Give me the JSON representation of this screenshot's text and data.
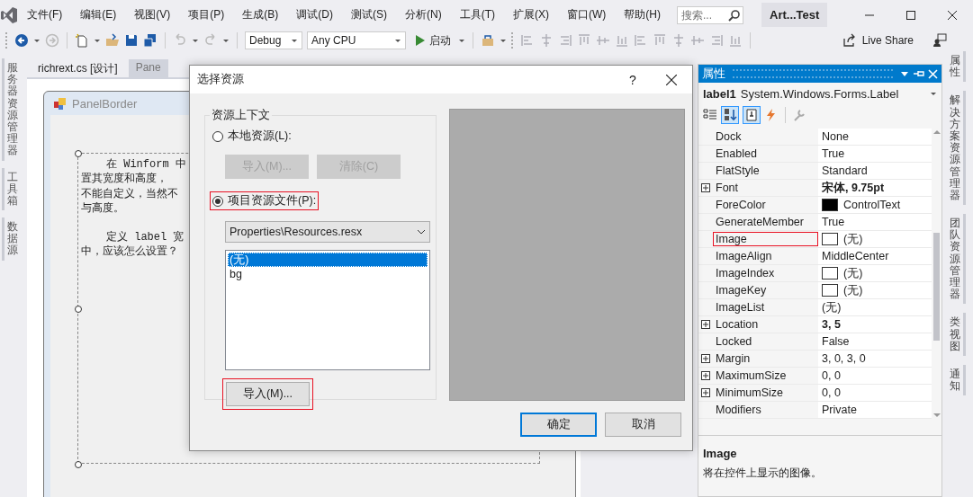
{
  "menu": [
    "文件(F)",
    "编辑(E)",
    "视图(V)",
    "项目(P)",
    "生成(B)",
    "调试(D)",
    "测试(S)",
    "分析(N)",
    "工具(T)",
    "扩展(X)",
    "窗口(W)",
    "帮助(H)"
  ],
  "search": {
    "placeholder": "搜索..."
  },
  "window": {
    "title": "Art...Test"
  },
  "toolbar": {
    "configuration": "Debug",
    "platform": "Any CPU",
    "start": "启动",
    "live_share": "Live Share"
  },
  "left_tabs": [
    "服务器资源管理器",
    "工具箱",
    "数据源"
  ],
  "documents": {
    "tabs": [
      {
        "label": "richrext.cs [设计]",
        "selected": false
      },
      {
        "label": "Pane",
        "selected": true
      }
    ],
    "form": {
      "title": "PanelBorder",
      "paragraphs": [
        [
          "在 Winform 中",
          "置其宽度和高度，",
          "不能自定义，当然不",
          "与高度。"
        ],
        [
          "定义 label 宽",
          "中，应该怎么设置？"
        ]
      ]
    }
  },
  "dialog": {
    "title": "选择资源",
    "help": "?",
    "group_title": "资源上下文",
    "options": [
      {
        "label": "本地资源(L):",
        "selected": false,
        "highlighted": false
      },
      {
        "label": "项目资源文件(P):",
        "selected": true,
        "highlighted": true
      }
    ],
    "local_buttons": [
      {
        "label": "导入(M)...",
        "disabled": true
      },
      {
        "label": "清除(C)",
        "disabled": true
      }
    ],
    "resource_file": "Properties\\Resources.resx",
    "resources": [
      {
        "label": "(无)",
        "selected": true
      },
      {
        "label": "bg",
        "selected": false
      }
    ],
    "import_button": {
      "label": "导入(M)...",
      "highlighted": true
    },
    "buttons": [
      {
        "label": "确定",
        "default": true
      },
      {
        "label": "取消",
        "default": false
      }
    ]
  },
  "properties": {
    "title": "属性",
    "object": {
      "name": "label1",
      "type": "System.Windows.Forms.Label"
    },
    "rows": [
      {
        "name": "Dock",
        "value": "None",
        "kind": "text",
        "expandable": false,
        "bold": false,
        "highlighted": false
      },
      {
        "name": "Enabled",
        "value": "True",
        "kind": "text",
        "expandable": false,
        "bold": false,
        "highlighted": false
      },
      {
        "name": "FlatStyle",
        "value": "Standard",
        "kind": "text",
        "expandable": false,
        "bold": false,
        "highlighted": false
      },
      {
        "name": "Font",
        "value": "宋体, 9.75pt",
        "kind": "text",
        "expandable": true,
        "bold": true,
        "highlighted": false
      },
      {
        "name": "ForeColor",
        "value": "ControlText",
        "kind": "color",
        "color": "#000000",
        "expandable": false,
        "bold": false,
        "highlighted": false
      },
      {
        "name": "GenerateMember",
        "value": "True",
        "kind": "text",
        "expandable": false,
        "bold": false,
        "highlighted": false
      },
      {
        "name": "Image",
        "value": "(无)",
        "kind": "image",
        "expandable": false,
        "bold": false,
        "highlighted": true
      },
      {
        "name": "ImageAlign",
        "value": "MiddleCenter",
        "kind": "text",
        "expandable": false,
        "bold": false,
        "highlighted": false
      },
      {
        "name": "ImageIndex",
        "value": "(无)",
        "kind": "image",
        "expandable": false,
        "bold": false,
        "highlighted": false
      },
      {
        "name": "ImageKey",
        "value": "(无)",
        "kind": "image",
        "expandable": false,
        "bold": false,
        "highlighted": false
      },
      {
        "name": "ImageList",
        "value": "(无)",
        "kind": "text",
        "expandable": false,
        "bold": false,
        "highlighted": false
      },
      {
        "name": "Location",
        "value": "3, 5",
        "kind": "text",
        "expandable": true,
        "bold": true,
        "highlighted": false
      },
      {
        "name": "Locked",
        "value": "False",
        "kind": "text",
        "expandable": false,
        "bold": false,
        "highlighted": false
      },
      {
        "name": "Margin",
        "value": "3, 0, 3, 0",
        "kind": "text",
        "expandable": true,
        "bold": false,
        "highlighted": false
      },
      {
        "name": "MaximumSize",
        "value": "0, 0",
        "kind": "text",
        "expandable": true,
        "bold": false,
        "highlighted": false
      },
      {
        "name": "MinimumSize",
        "value": "0, 0",
        "kind": "text",
        "expandable": true,
        "bold": false,
        "highlighted": false
      },
      {
        "name": "Modifiers",
        "value": "Private",
        "kind": "text",
        "expandable": false,
        "bold": false,
        "highlighted": false
      }
    ],
    "description": {
      "title": "Image",
      "text": "将在控件上显示的图像。"
    }
  },
  "right_tabs": [
    "属性",
    "解决方案资源管理器",
    "团队资源管理器",
    "类视图",
    "通知"
  ]
}
